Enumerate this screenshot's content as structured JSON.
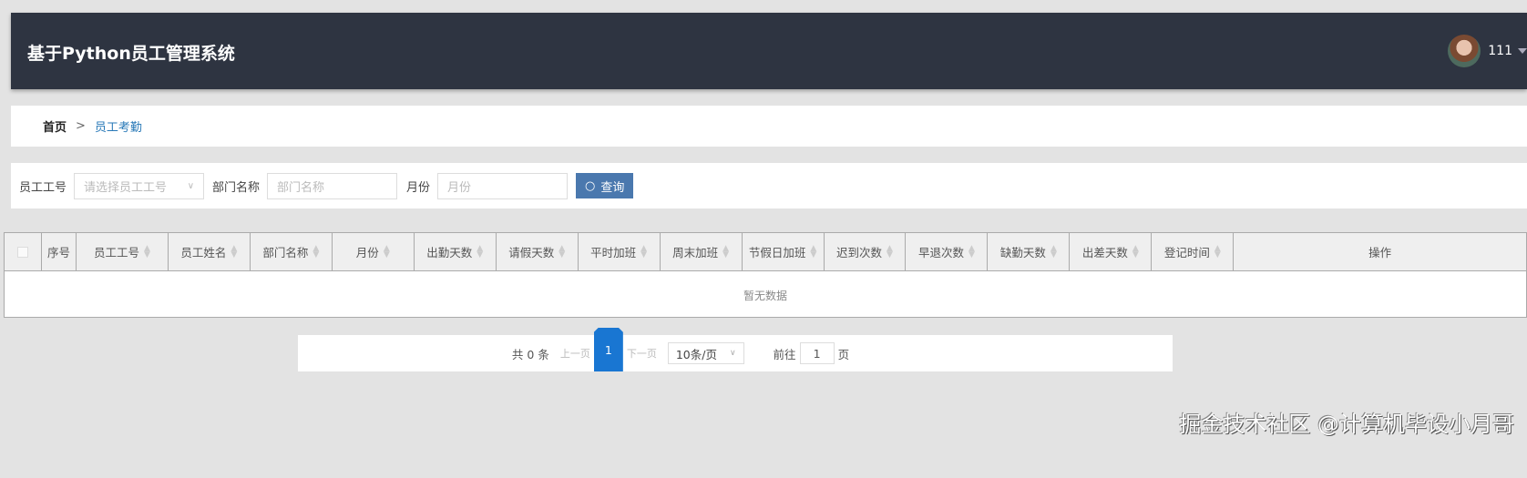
{
  "header": {
    "title": "基于Python员工管理系统",
    "username": "111"
  },
  "breadcrumb": {
    "home": "首页",
    "separator": ">",
    "current": "员工考勤"
  },
  "search": {
    "emp_no_label": "员工工号",
    "emp_no_placeholder": "请选择员工工号",
    "dept_label": "部门名称",
    "dept_placeholder": "部门名称",
    "month_label": "月份",
    "month_placeholder": "月份",
    "query_button": "查询"
  },
  "table": {
    "columns": [
      "序号",
      "员工工号",
      "员工姓名",
      "部门名称",
      "月份",
      "出勤天数",
      "请假天数",
      "平时加班",
      "周末加班",
      "节假日加班",
      "迟到次数",
      "早退次数",
      "缺勤天数",
      "出差天数",
      "登记时间",
      "操作"
    ],
    "empty_text": "暂无数据"
  },
  "pagination": {
    "total": "共 0 条",
    "prev": "上一页",
    "current": "1",
    "next": "下一页",
    "page_size": "10条/页",
    "goto_label": "前往",
    "goto_value": "1",
    "page_suffix": "页"
  },
  "watermark": "掘金技术社区 @计算机毕设小月哥"
}
